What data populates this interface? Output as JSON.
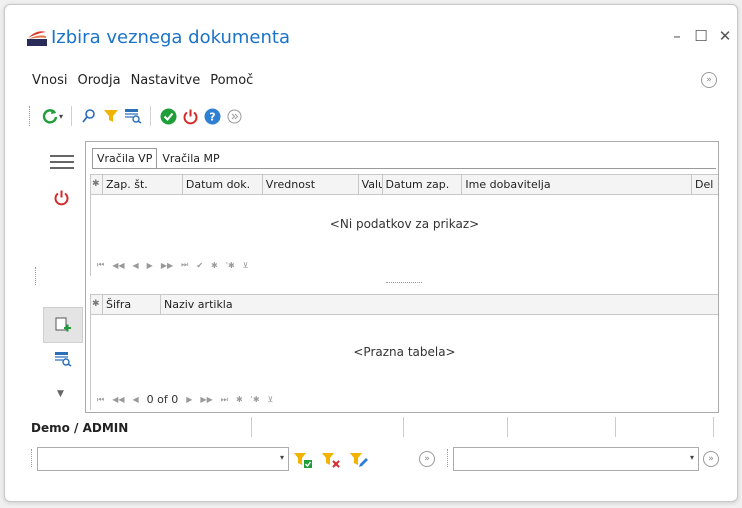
{
  "window": {
    "title": "Izbira veznega dokumenta",
    "minimize": "–",
    "maximize": "☐",
    "close": "✕"
  },
  "menu": {
    "items": [
      {
        "prefix": "",
        "underlined": "V",
        "rest": "nosi"
      },
      {
        "prefix": "",
        "underlined": "O",
        "rest": "rodja"
      },
      {
        "prefix": "",
        "underlined": "N",
        "rest": "astavitve"
      },
      {
        "prefix": "Pomoč",
        "underlined": "",
        "rest": ""
      }
    ],
    "expand_glyph": "»"
  },
  "toolbar": {
    "refresh_drop": "▾"
  },
  "tabs": [
    {
      "label": "Vračila VP",
      "active": true
    },
    {
      "label": "Vračila MP",
      "active": false
    }
  ],
  "top_grid": {
    "selector_glyph": "✱",
    "columns": [
      "Zap. št.",
      "Datum dok.",
      "Vrednost",
      "Valu",
      "Datum zap.",
      "Ime dobavitelja",
      "Del"
    ],
    "empty_text": "<Ni podatkov za prikaz>",
    "nav": [
      "⏮",
      "◀◀",
      "◀",
      "▶",
      "▶▶",
      "⏭",
      "✔",
      "✱",
      "'✱",
      "⊻"
    ]
  },
  "bottom_grid": {
    "selector_glyph": "✱",
    "columns": [
      "Šifra",
      "Naziv artikla"
    ],
    "empty_text": "<Prazna tabela>",
    "record_text": "0 of 0",
    "nav_before": [
      "⏮",
      "◀◀",
      "◀"
    ],
    "nav_after": [
      "▶",
      "▶▶",
      "⏭",
      "✱",
      "'✱",
      "⊻"
    ]
  },
  "status": {
    "user_label": "Demo / ADMIN"
  },
  "filter": {
    "combo_arrow": "▾",
    "nav_glyph": "»"
  },
  "colors": {
    "title": "#1a73c9",
    "refresh": "#1f9e3a",
    "filter": "#f0b400",
    "ok": "#1f9e3a",
    "power": "#d42a2a",
    "help": "#2f7fd3"
  }
}
